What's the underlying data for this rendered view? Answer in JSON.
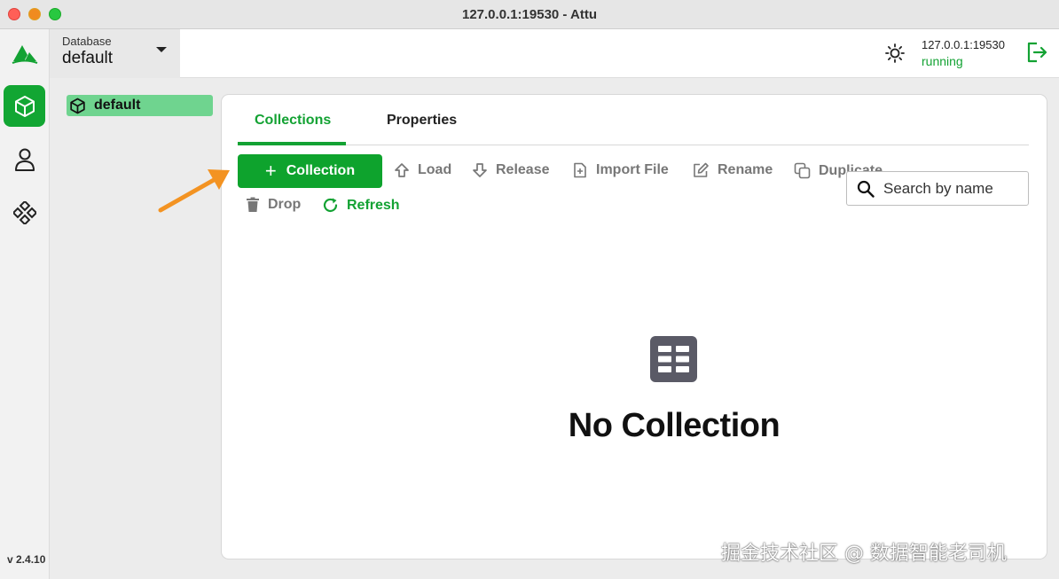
{
  "window": {
    "title": "127.0.0.1:19530 - Attu"
  },
  "rail": {
    "items": [
      {
        "name": "databases"
      },
      {
        "name": "users"
      },
      {
        "name": "system"
      }
    ],
    "version": "v 2.4.10"
  },
  "header": {
    "database_label": "Database",
    "database_value": "default",
    "server_address": "127.0.0.1:19530",
    "server_status": "running"
  },
  "tree": {
    "items": [
      {
        "label": "default"
      }
    ]
  },
  "tabs": [
    {
      "label": "Collections",
      "active": true
    },
    {
      "label": "Properties",
      "active": false
    }
  ],
  "toolbar": {
    "create_label": "Collection",
    "load_label": "Load",
    "release_label": "Release",
    "import_label": "Import File",
    "rename_label": "Rename",
    "duplicate_label": "Duplicate",
    "drop_label": "Drop",
    "refresh_label": "Refresh"
  },
  "search": {
    "placeholder": "Search by name"
  },
  "empty": {
    "message": "No Collection"
  },
  "watermark": "掘金技术社区 @ 数据智能老司机",
  "colors": {
    "accent": "#13a233",
    "button": "#0ea32d",
    "tree_highlight": "#6fd48f",
    "arrow": "#f39322"
  },
  "icons": [
    "milvus-logo-icon",
    "cube-icon",
    "user-icon",
    "system-icon",
    "sun-icon",
    "logout-icon",
    "arrow-up-icon",
    "arrow-down-icon",
    "file-plus-icon",
    "edit-icon",
    "copy-icon",
    "trash-icon",
    "refresh-icon",
    "search-icon",
    "table-icon"
  ]
}
